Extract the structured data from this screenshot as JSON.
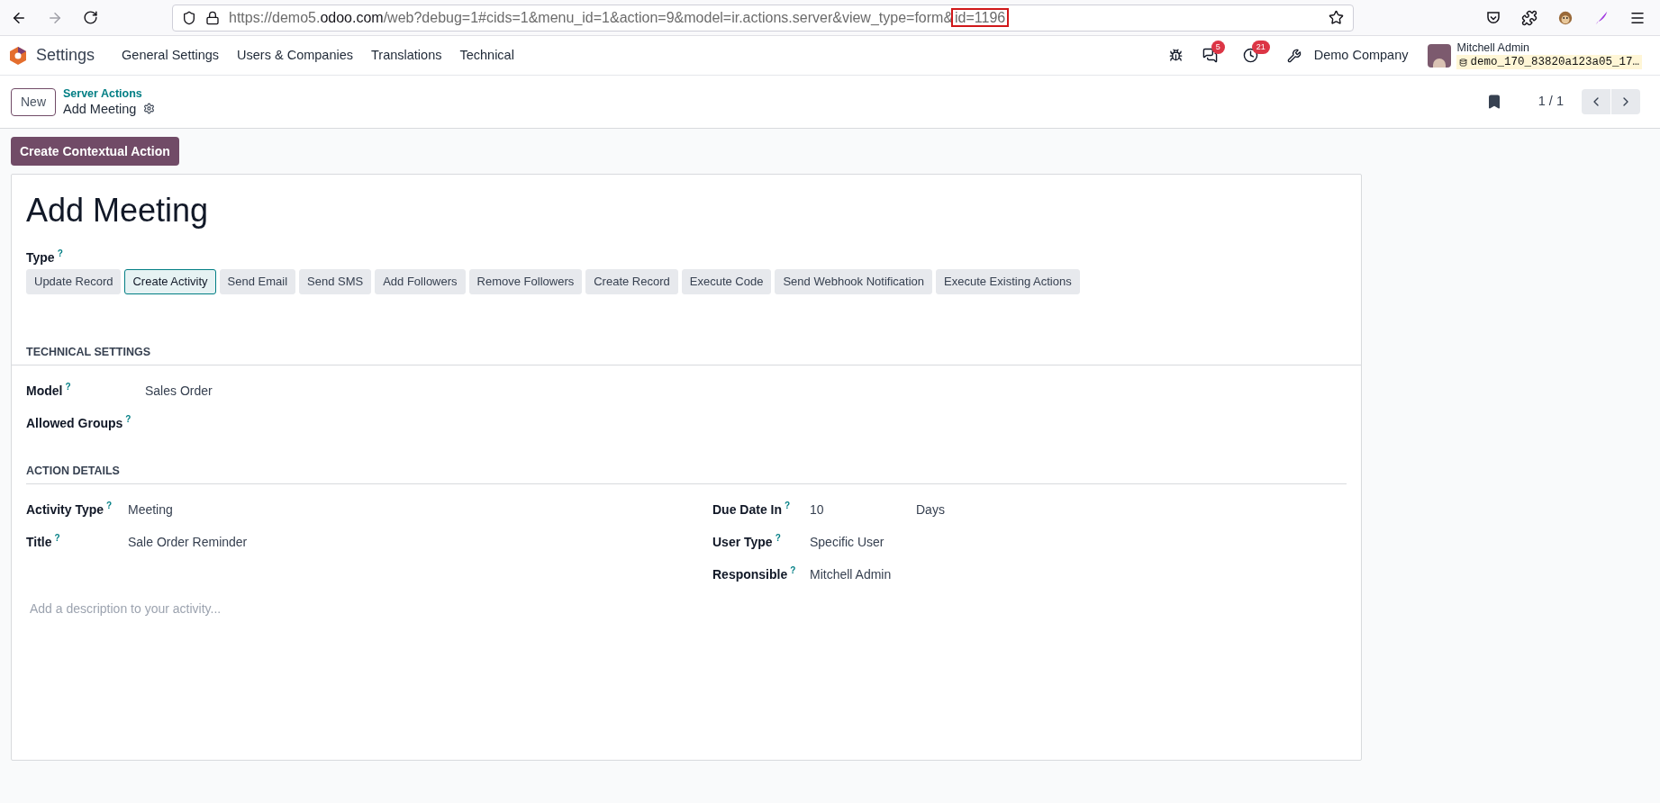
{
  "browser": {
    "url_parts": [
      {
        "text": "https://demo5.",
        "kind": "muted"
      },
      {
        "text": "odoo.com",
        "kind": "domain"
      },
      {
        "text": "/web?debug=1#cids=1&menu_id=1&action=9&model=ir.actions.server&view_type=form&",
        "kind": "muted"
      },
      {
        "text": "id=1196",
        "kind": "highlighted"
      }
    ]
  },
  "navbar": {
    "app_name": "Settings",
    "menus": [
      "General Settings",
      "Users & Companies",
      "Translations",
      "Technical"
    ],
    "messages_badge": "5",
    "activities_badge": "21",
    "company": "Demo Company",
    "user_name": "Mitchell Admin",
    "database": "demo_170_83820a123a05_17…"
  },
  "control_panel": {
    "new_button": "New",
    "breadcrumb": "Server Actions",
    "record_title": "Add Meeting",
    "pager": "1 / 1"
  },
  "contextual_action_button": "Create Contextual Action",
  "form": {
    "title": "Add Meeting",
    "type_label": "Type",
    "type_help": "?",
    "type_options": [
      {
        "label": "Update Record",
        "selected": false
      },
      {
        "label": "Create Activity",
        "selected": true
      },
      {
        "label": "Send Email",
        "selected": false
      },
      {
        "label": "Send SMS",
        "selected": false
      },
      {
        "label": "Add Followers",
        "selected": false
      },
      {
        "label": "Remove Followers",
        "selected": false
      },
      {
        "label": "Create Record",
        "selected": false
      },
      {
        "label": "Execute Code",
        "selected": false
      },
      {
        "label": "Send Webhook Notification",
        "selected": false
      },
      {
        "label": "Execute Existing Actions",
        "selected": false
      }
    ],
    "technical_settings": {
      "heading": "TECHNICAL SETTINGS",
      "fields": [
        {
          "label": "Model",
          "help": "?",
          "value": "Sales Order"
        },
        {
          "label": "Allowed Groups",
          "help": "?"
        }
      ]
    },
    "action_details": {
      "heading": "ACTION DETAILS",
      "left_fields": [
        {
          "label": "Activity Type",
          "help": "?",
          "value": "Meeting"
        },
        {
          "label": "Title",
          "help": "?",
          "value": "Sale Order Reminder"
        }
      ],
      "right_fields": [
        {
          "label": "Due Date In",
          "help": "?",
          "value": "10",
          "unit": "Days"
        },
        {
          "label": "User Type",
          "help": "?",
          "value": "Specific User"
        },
        {
          "label": "Responsible",
          "help": "?",
          "value": "Mitchell Admin"
        }
      ]
    },
    "description_placeholder": "Add a description to your activity..."
  }
}
